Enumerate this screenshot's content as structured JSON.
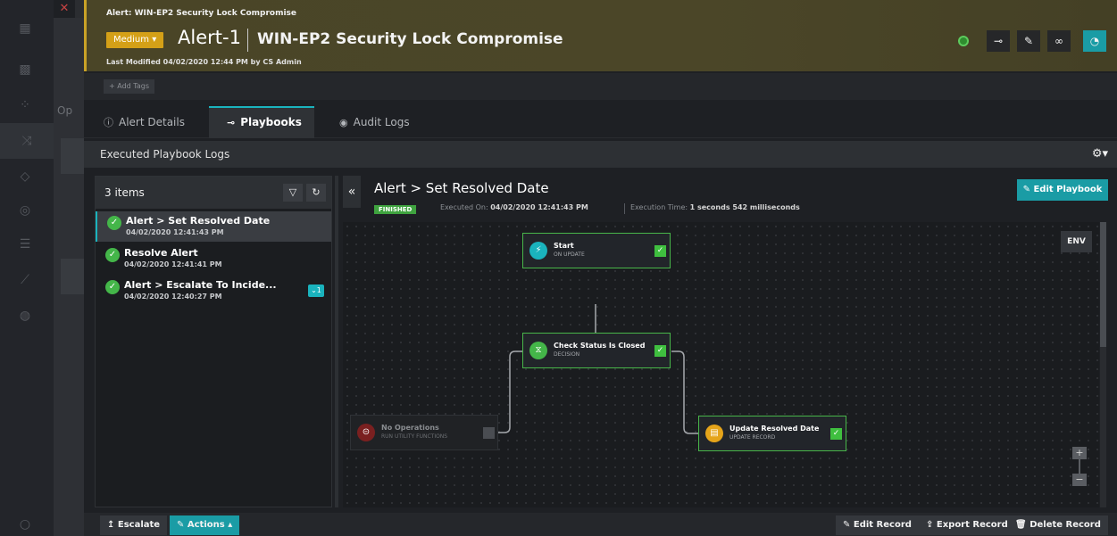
{
  "alert": {
    "small_title": "Alert: WIN-EP2 Security Lock Compromise",
    "severity": "Medium",
    "id": "Alert-1",
    "title": "WIN-EP2 Security Lock Compromise",
    "last_modified": "Last Modified 04/02/2020 12:44 PM by CS Admin",
    "add_tags": "+ Add Tags"
  },
  "backdrop": {
    "fragment": "Op"
  },
  "tabs": [
    {
      "label": "Alert Details",
      "icon": "info-icon"
    },
    {
      "label": "Playbooks",
      "icon": "playbook-icon"
    },
    {
      "label": "Audit Logs",
      "icon": "eye-icon"
    }
  ],
  "logs": {
    "title": "Executed Playbook Logs",
    "count": "3 items",
    "items": [
      {
        "name": "Alert > Set Resolved Date",
        "date": "04/02/2020 12:41:43 PM"
      },
      {
        "name": "Resolve Alert",
        "date": "04/02/2020 12:41:41 PM"
      },
      {
        "name": "Alert > Escalate To Incide...",
        "date": "04/02/2020 12:40:27 PM",
        "badge": "1"
      }
    ]
  },
  "detail": {
    "title": "Alert > Set Resolved Date",
    "status": "FINISHED",
    "executed_label": "Executed On:",
    "executed_on": "04/02/2020 12:41:43 PM",
    "time_label": "Execution Time:",
    "execution_time": "1 seconds 542 milliseconds",
    "edit_playbook": "Edit Playbook",
    "env": "ENV"
  },
  "nodes": [
    {
      "title": "Start",
      "subtitle": "ON UPDATE"
    },
    {
      "title": "Check Status Is Closed",
      "subtitle": "DECISION"
    },
    {
      "title": "No Operations",
      "subtitle": "RUN UTILITY FUNCTIONS"
    },
    {
      "title": "Update Resolved Date",
      "subtitle": "UPDATE RECORD"
    }
  ],
  "bottom": {
    "escalate": "Escalate",
    "actions": "Actions",
    "edit_record": "Edit Record",
    "export_record": "Export Record",
    "delete_record": "Delete Record"
  },
  "colors": {
    "accent": "#1ab3bd",
    "success": "#44b649",
    "severity": "#d4a017",
    "header_bg": "#4a4527"
  }
}
